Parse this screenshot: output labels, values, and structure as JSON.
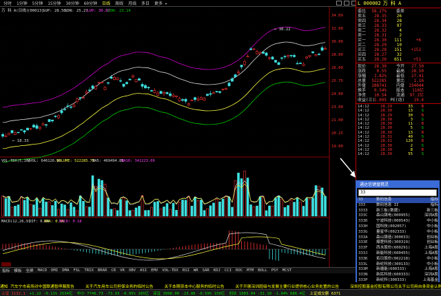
{
  "toolbar": {
    "items": [
      "分时",
      "1分钟",
      "5分钟",
      "15分钟",
      "30分钟",
      "60分钟",
      "日线",
      "周线",
      "月线",
      "多日",
      "更多 ▸"
    ],
    "active_index": 6
  },
  "chart_header": {
    "title": "万 科 A(日线)",
    "ma_text": "(00013)",
    "sup": "SUP: 28.50",
    "sdn": "SDN: 25.27",
    "lup": "LUP: 30.87",
    "ldn": "LDN: 23.14"
  },
  "price_axis": [
    "34.09",
    "32.00",
    "30.00",
    "28.00",
    "26.00",
    "25.75",
    "24.00",
    "23.00",
    "21.00",
    "20.25",
    "19.00"
  ],
  "annotations": {
    "high": "30.22",
    "low": "18.33"
  },
  "volume_header": {
    "label": "VOL-TDX(5,10)",
    "vvol": "VVOL: 646126.88",
    "volume": "VOLUME: 522285.75",
    "ma5": "MA5: 469494.81",
    "ma10": "MA10: 341223.69"
  },
  "macd_header": {
    "label": "MACD(12,26,9)",
    "dif": "DIF: 0.44",
    "dea": "DEA: 0.35",
    "macd": "MACD: 0.18"
  },
  "bottom_tabs": [
    "指标",
    "模板",
    "全屏",
    "MACD",
    "DMI",
    "DMA",
    "FSL",
    "TRIX",
    "BRAR",
    "CR",
    "VR",
    "OBV",
    "ASI",
    "EMV",
    "VOL-TDX",
    "RSI",
    "WR",
    "SAR",
    "KDJ",
    "CCI",
    "ROC",
    "MTM",
    "BOLL",
    "PSY",
    "MCST"
  ],
  "right_panel": {
    "code": "L 000002",
    "name": "万 科 A",
    "depth": [
      {
        "k": "委比",
        "v": "58.27%",
        "k2": "委差",
        "v2": ""
      },
      {
        "k": "卖五",
        "v": "28.35",
        "n": "26",
        "f": ""
      },
      {
        "k": "卖四",
        "v": "28.34",
        "n": "28",
        "f": ""
      },
      {
        "k": "卖三",
        "v": "28.33",
        "n": "97",
        "f": ""
      },
      {
        "k": "卖二",
        "v": "28.32",
        "n": "4",
        "f": ""
      },
      {
        "k": "卖一",
        "v": "28.31",
        "n": "2",
        "f": ""
      },
      {
        "k": "买一",
        "v": "28.30",
        "n": "111",
        "f": "+6"
      },
      {
        "k": "买二",
        "v": "28.29",
        "n": "10",
        "f": ""
      },
      {
        "k": "买三",
        "v": "28.28",
        "n": "151",
        "f": "+151"
      },
      {
        "k": "买四",
        "v": "28.27",
        "n": "32",
        "f": ""
      },
      {
        "k": "买五",
        "v": "28.26",
        "n": "651",
        "f": "+51"
      }
    ],
    "stats": [
      {
        "k": "现价",
        "v": "28.30",
        "k2": "今开",
        "v2": "27.50"
      },
      {
        "k": "涨跌",
        "v": "0.55",
        "k2": "最高",
        "v2": "28.50"
      },
      {
        "k": "涨幅",
        "v": "1.82%",
        "k2": "最低",
        "v2": "27.41"
      },
      {
        "k": "总量",
        "v": "522285",
        "k2": "量比",
        "v2": "1.16"
      },
      {
        "k": "外盘",
        "v": "288741",
        "k2": "内盘",
        "v2": "234044"
      },
      {
        "k": "换手",
        "v": "0.54%",
        "k2": "股本",
        "v2": "110亿"
      },
      {
        "k": "净资",
        "v": "10.54",
        "k2": "流通",
        "v2": "97.2亿"
      },
      {
        "k": "收益(三)",
        "v": "1.095",
        "k2": "PE(动)",
        "v2": "19.4"
      }
    ],
    "ticks": [
      {
        "t": "14:12",
        "p": "28.29",
        "v": "33",
        "f": "B"
      },
      {
        "t": "14:12",
        "p": "28.30",
        "v": "13",
        "f": "S"
      },
      {
        "t": "14:12",
        "p": "28.29",
        "v": "30",
        "f": "B"
      },
      {
        "t": "14:12",
        "p": "28.30",
        "v": "3",
        "f": "S"
      },
      {
        "t": "14:12",
        "p": "28.30",
        "v": "11",
        "f": "B"
      },
      {
        "t": "14:12",
        "p": "28.30",
        "v": "5",
        "f": "S"
      },
      {
        "t": "14:12",
        "p": "28.30",
        "v": "13",
        "f": "B"
      },
      {
        "t": "14:12",
        "p": "28.31",
        "v": "40",
        "f": "S"
      },
      {
        "t": "14:12",
        "p": "28.31",
        "v": "120",
        "f": "B"
      },
      {
        "t": "14:12",
        "p": "28.30",
        "v": "2",
        "f": "S"
      },
      {
        "t": "14:12",
        "p": "28.30",
        "v": "8",
        "f": "B"
      },
      {
        "t": "14:12",
        "p": "28.30",
        "v": "55",
        "f": "S"
      }
    ]
  },
  "popup": {
    "title": "通达信键盘精灵",
    "input": "33",
    "rows": [
      {
        "c": "33",
        "n": "数码信息",
        "t": "指标",
        "sel": true
      },
      {
        "c": "333",
        "n": "数码信息 II",
        "t": "指标"
      },
      {
        "c": "3333",
        "n": "新三板(数据)",
        "t": "新三板"
      },
      {
        "c": "333C",
        "n": "森山铸电(000955)",
        "t": "深圳A股"
      },
      {
        "c": "333D",
        "n": "宁波科技(000543)",
        "t": "中小板"
      },
      {
        "c": "333H",
        "n": "国科技(002057)",
        "t": "中小板"
      },
      {
        "c": "333G",
        "n": "量星华(002333)",
        "t": "中小板"
      },
      {
        "c": "333A",
        "n": "森山铸造(300033)",
        "t": "创业板"
      },
      {
        "c": "333E",
        "n": "爆楚科技(300319)",
        "t": "创业板"
      },
      {
        "c": "333F",
        "n": "西水股份(600291)",
        "t": "上海A股"
      },
      {
        "c": "333J",
        "n": "新能科技(600455)",
        "t": "上海A股"
      },
      {
        "c": "333K",
        "n": "拓日股份(002218)",
        "t": "中小板"
      },
      {
        "c": "333L",
        "n": "新纶科技(300133)",
        "t": "中小板"
      },
      {
        "c": "333M",
        "n": "新疆能(600333)",
        "t": "上海A股"
      },
      {
        "c": "333N",
        "n": "新民科技(600333)",
        "t": "深圳A股"
      },
      {
        "c": "333P",
        "n": "新纶科(300333)",
        "t": "上海基金"
      }
    ]
  },
  "news": [
    "通知 汽车宁市商场对中国联通暂停服股告",
    "关于汽车用车公司担保业务的临时公告",
    "关于本期资本中心服务的临时公告",
    "关于开展深圳超级与发展主要行业提供核心业务处置的公告",
    "深圳控股基金控股有限公司关于公司用自身资金认购地产入股的公告"
  ],
  "status": [
    {
      "s": "上证 1132.1",
      "c": "red"
    },
    {
      "s": "+1.22 -0.11% 2534亿",
      "c": "grn"
    },
    {
      "s": "中小 7746.73 -73.93 -0.95% 165亿",
      "c": "grn"
    },
    {
      "s": "深证 3998.00 -23.86 -0.59% 159亿",
      "c": "grn"
    },
    {
      "s": "创业 1083.04 -31.10 -1.04% 686.4亿",
      "c": "grn"
    },
    {
      "s": "上证成交额 6371",
      "c": "yel"
    }
  ]
}
